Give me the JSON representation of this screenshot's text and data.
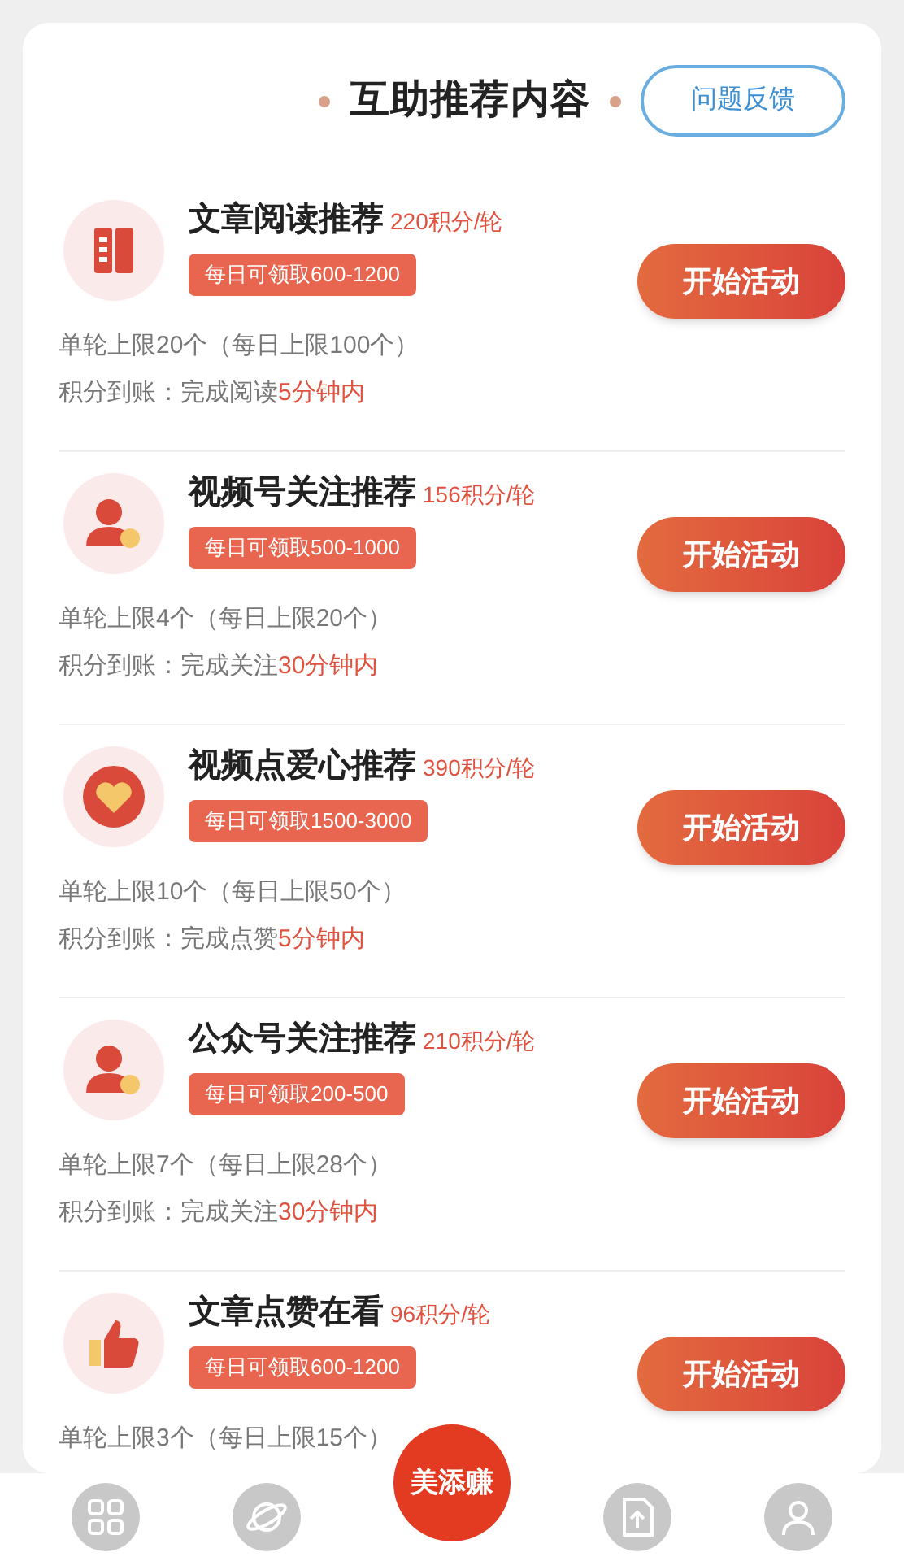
{
  "header": {
    "title": "互助推荐内容",
    "feedback_button": "问题反馈"
  },
  "tasks": [
    {
      "kind": "book",
      "title": "文章阅读推荐",
      "points": "220积分/轮",
      "daily": "每日可领取600-1200",
      "limit": "单轮上限20个（每日上限100个）",
      "arrival_label": "积分到账：完成阅读",
      "arrival_time": "5分钟内",
      "button": "开始活动"
    },
    {
      "kind": "person",
      "title": "视频号关注推荐",
      "points": "156积分/轮",
      "daily": "每日可领取500-1000",
      "limit": "单轮上限4个（每日上限20个）",
      "arrival_label": "积分到账：完成关注",
      "arrival_time": "30分钟内",
      "button": "开始活动"
    },
    {
      "kind": "heart",
      "title": "视频点爱心推荐",
      "points": "390积分/轮",
      "daily": "每日可领取1500-3000",
      "limit": "单轮上限10个（每日上限50个）",
      "arrival_label": "积分到账：完成点赞",
      "arrival_time": "5分钟内",
      "button": "开始活动"
    },
    {
      "kind": "person",
      "title": "公众号关注推荐",
      "points": "210积分/轮",
      "daily": "每日可领取200-500",
      "limit": "单轮上限7个（每日上限28个）",
      "arrival_label": "积分到账：完成关注",
      "arrival_time": "30分钟内",
      "button": "开始活动"
    },
    {
      "kind": "thumb",
      "title": "文章点赞在看",
      "points": "96积分/轮",
      "daily": "每日可领取600-1200",
      "limit": "单轮上限3个（每日上限15个）",
      "button": "开始活动"
    }
  ],
  "bottom_nav": [
    {
      "kind": "grid"
    },
    {
      "kind": "planet"
    },
    {
      "kind": "logo",
      "label": "美添赚"
    },
    {
      "kind": "upload"
    },
    {
      "kind": "user"
    }
  ]
}
